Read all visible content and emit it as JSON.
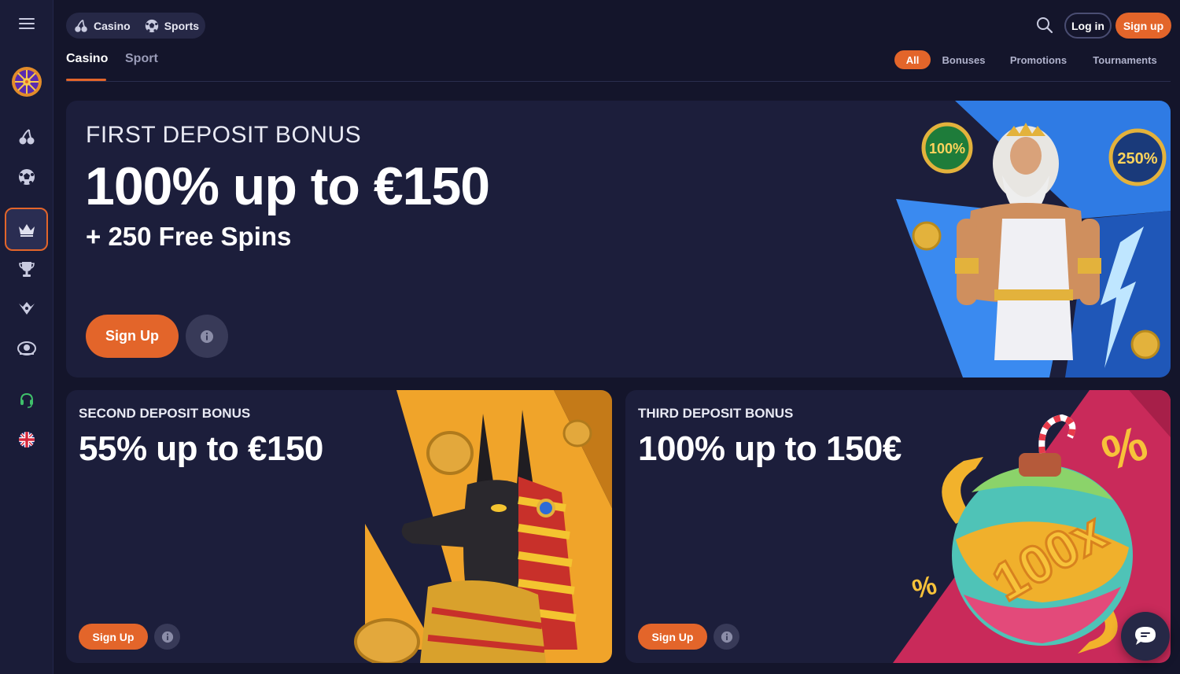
{
  "header": {
    "segments": [
      {
        "label": "Casino",
        "icon": "cherry-icon"
      },
      {
        "label": "Sports",
        "icon": "soccer-ball-icon"
      }
    ],
    "login_label": "Log in",
    "signup_label": "Sign up"
  },
  "tabs": [
    {
      "label": "Casino",
      "active": true
    },
    {
      "label": "Sport",
      "active": false
    }
  ],
  "filters": [
    {
      "label": "All",
      "active": true
    },
    {
      "label": "Bonuses"
    },
    {
      "label": "Promotions"
    },
    {
      "label": "Tournaments"
    }
  ],
  "sidebar": {
    "icons": [
      "menu-icon",
      "wheel-of-fortune-icon",
      "cherry-icon",
      "soccer-ball-icon",
      "crown-icon",
      "trophy-icon",
      "vip-badge-icon",
      "live-casino-icon",
      "support-headset-icon",
      "uk-flag-icon"
    ],
    "active": "crown-icon"
  },
  "offers": [
    {
      "eyebrow": "FIRST DEPOSIT BONUS",
      "headline": "100% up to €150",
      "subline": "+ 250 Free Spins",
      "cta": "Sign Up"
    },
    {
      "eyebrow": "SECOND DEPOSIT BONUS",
      "headline": "55% up to €150",
      "cta": "Sign Up"
    },
    {
      "eyebrow": "THIRD DEPOSIT BONUS",
      "headline": "100% up to 150€",
      "cta": "Sign Up"
    }
  ],
  "art": {
    "badges": [
      "100%",
      "250%"
    ],
    "bomb_label": "100x",
    "percent_signs": [
      "%",
      "%"
    ]
  },
  "colors": {
    "accent": "#e3652a",
    "background": "#14152b",
    "card": "#1c1e3b",
    "sidebar": "#1a1c38"
  }
}
